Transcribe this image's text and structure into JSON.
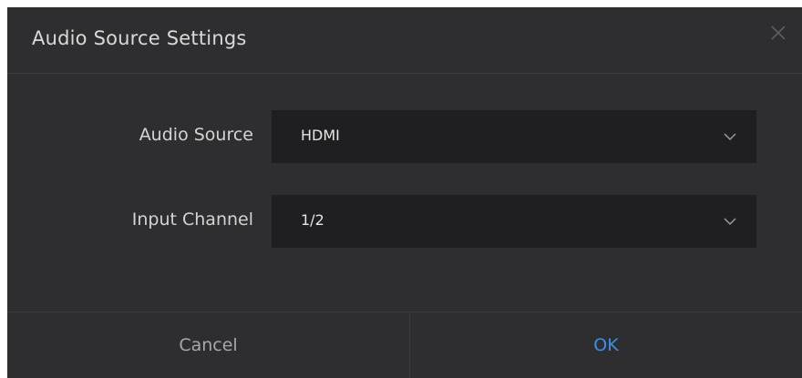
{
  "dialog": {
    "title": "Audio Source Settings",
    "close_icon": "close-icon"
  },
  "form": {
    "audio_source": {
      "label": "Audio Source",
      "value": "HDMI",
      "icon": "chevron-down-icon"
    },
    "input_channel": {
      "label": "Input Channel",
      "value": "1/2",
      "icon": "chevron-down-icon"
    }
  },
  "footer": {
    "cancel_label": "Cancel",
    "ok_label": "OK"
  },
  "colors": {
    "dialog_background": "#2e2e30",
    "field_background": "#1f1f21",
    "divider": "#3c3c3e",
    "accent": "#3b8fe8",
    "text_primary": "#d9d9d9",
    "text_muted": "#a8a8a8"
  }
}
